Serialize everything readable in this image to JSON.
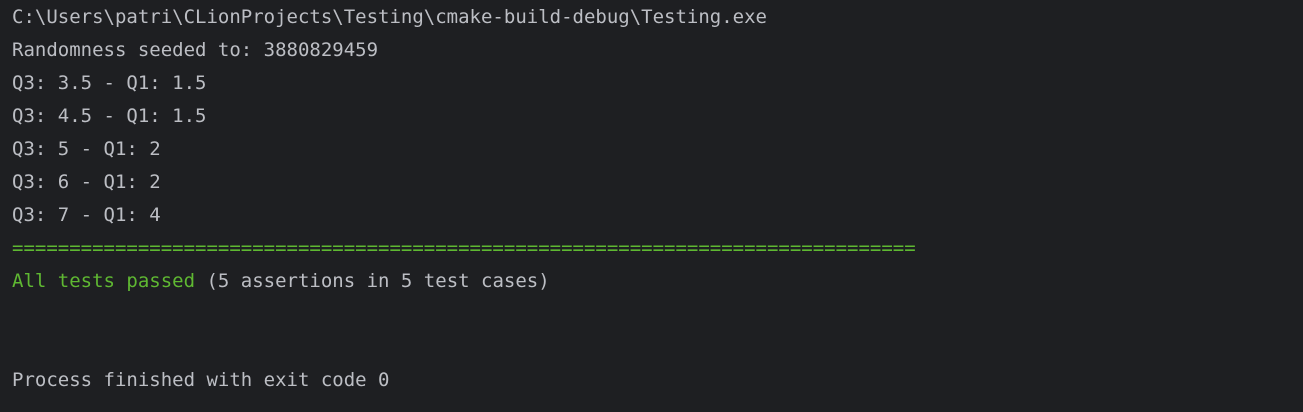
{
  "console": {
    "command_path": "C:\\Users\\patri\\CLionProjects\\Testing\\cmake-build-debug\\Testing.exe",
    "seed_line": "Randomness seeded to: 3880829459",
    "output_lines": [
      "Q3: 3.5 - Q1: 1.5",
      "Q3: 4.5 - Q1: 1.5",
      "Q3: 5 - Q1: 2",
      "Q3: 6 - Q1: 2",
      "Q3: 7 - Q1: 4"
    ],
    "separator": "===============================================================================",
    "summary_passed": "All tests passed",
    "summary_detail": " (5 assertions in 5 test cases)",
    "exit_message": "Process finished with exit code 0"
  },
  "colors": {
    "background": "#1e1f22",
    "text": "#bcbec4",
    "success": "#5fb832"
  }
}
